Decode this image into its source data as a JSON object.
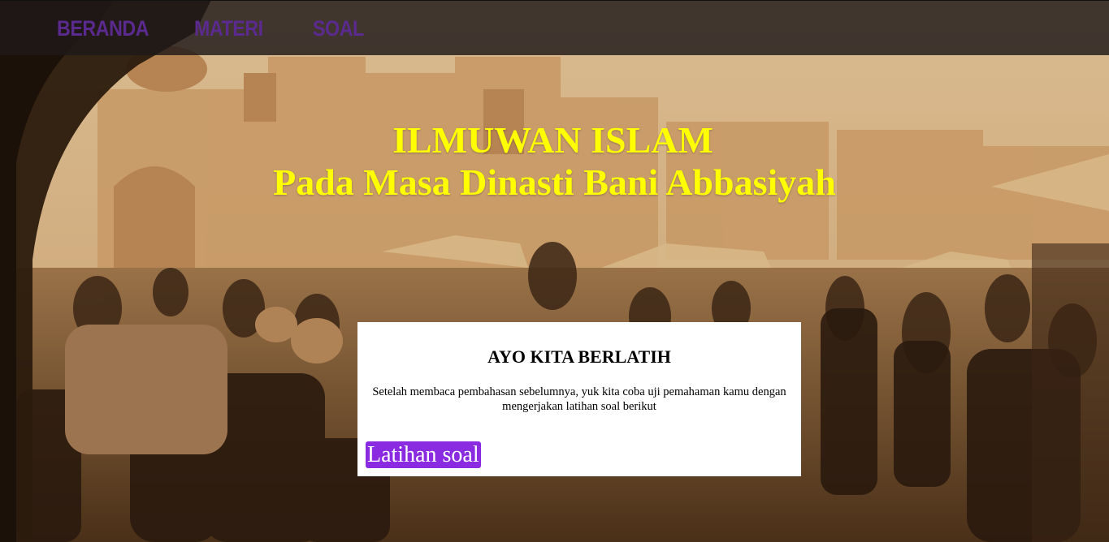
{
  "nav": {
    "items": [
      {
        "label": "BERANDA"
      },
      {
        "label": "MATERI"
      },
      {
        "label": "SOAL"
      }
    ]
  },
  "hero": {
    "title": "ILMUWAN ISLAM",
    "subtitle": "Pada Masa Dinasti Bani Abbasiyah"
  },
  "card": {
    "title": "AYO KITA BERLATIH",
    "text": "Setelah membaca pembahasan sebelumnya, yuk kita coba uji pemahaman kamu dengan mengerjakan latihan soal berikut",
    "button_label": "Latihan soal"
  },
  "colors": {
    "nav_text": "#5b2a8e",
    "hero_text": "#ffff00",
    "button_bg": "#8a2be2"
  }
}
